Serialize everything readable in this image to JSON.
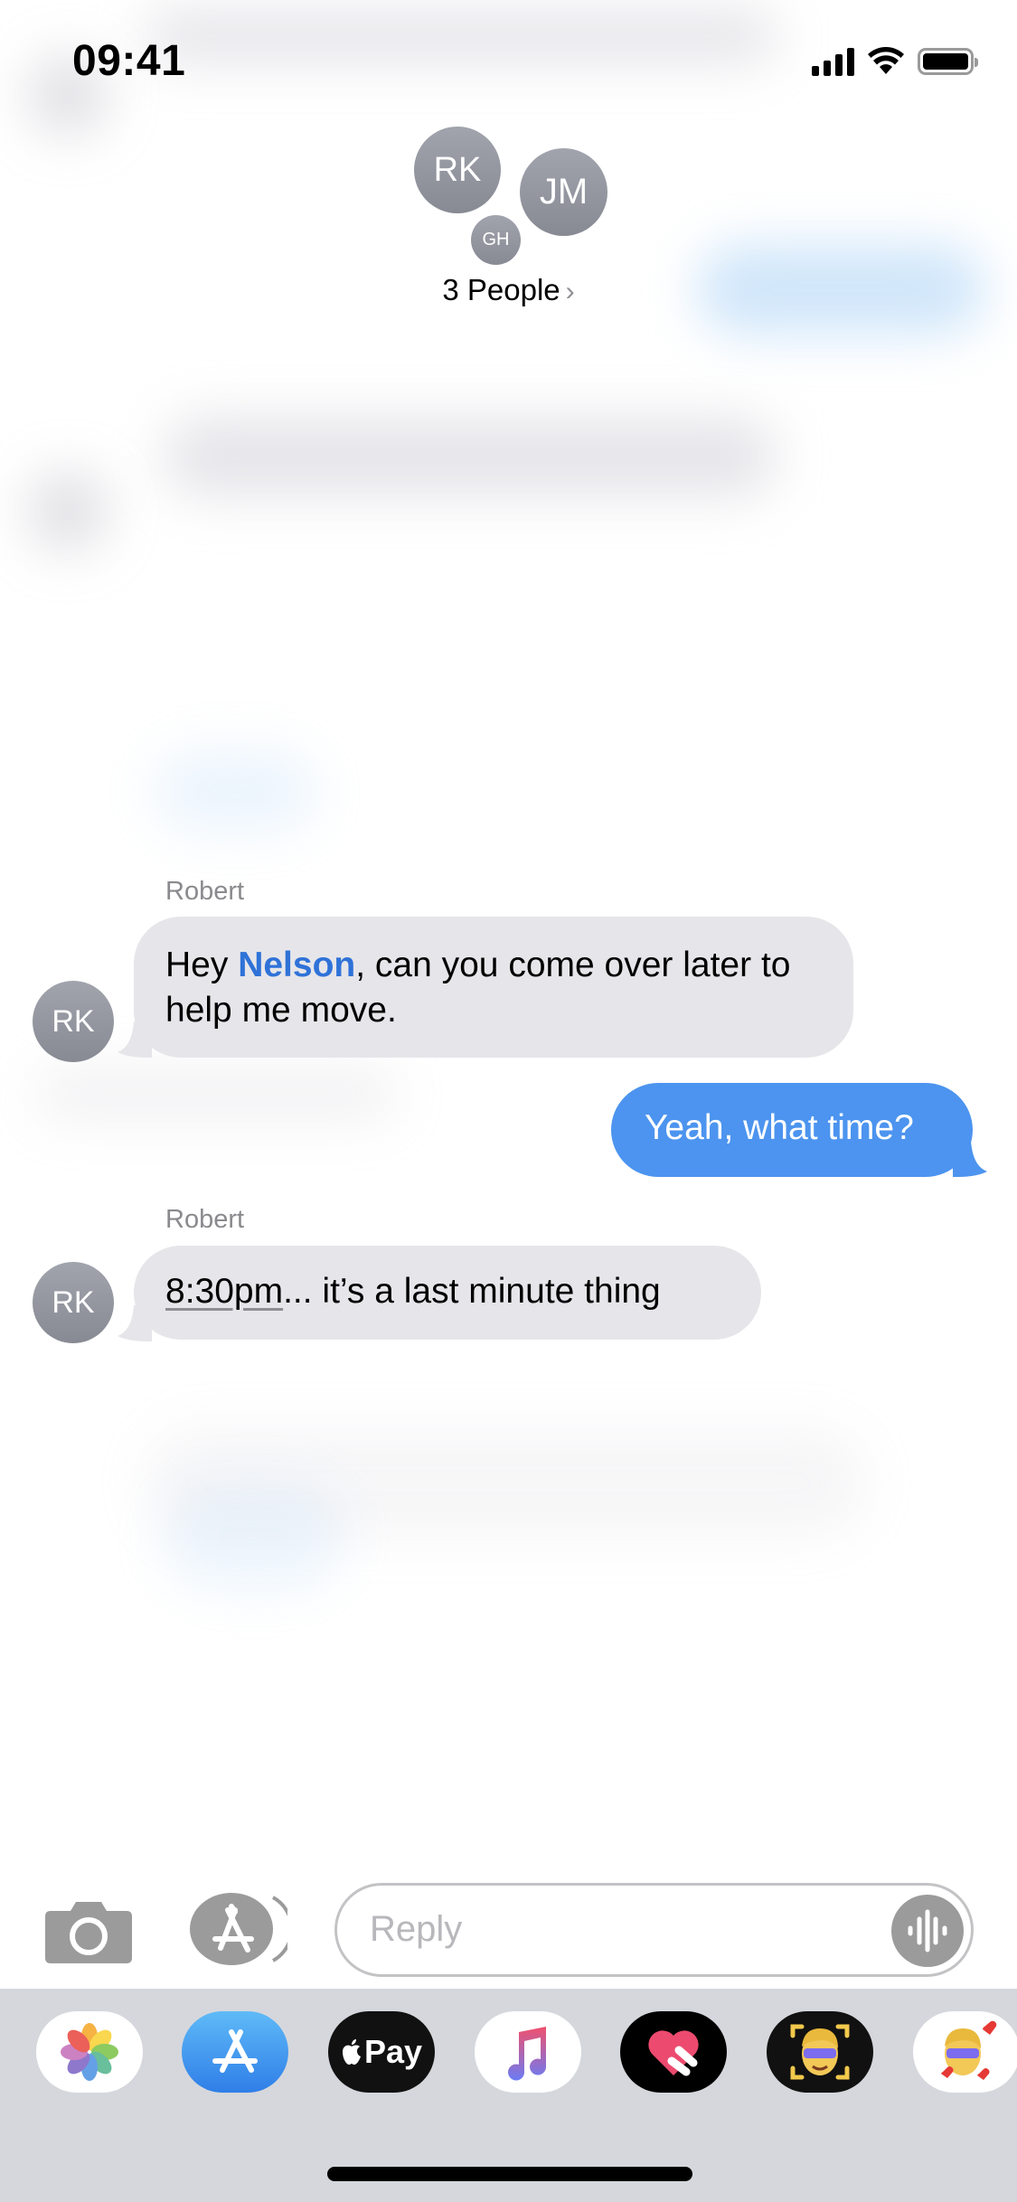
{
  "status_bar": {
    "time": "09:41",
    "signal_icon": "cellular-signal-icon",
    "wifi_icon": "wifi-icon",
    "battery_icon": "battery-full-icon"
  },
  "header": {
    "avatars": [
      {
        "initials": "RK"
      },
      {
        "initials": "JM"
      },
      {
        "initials": "GH"
      }
    ],
    "title": "3 People",
    "chevron": "›"
  },
  "messages": [
    {
      "direction": "incoming",
      "sender": "Robert",
      "avatar_initials": "RK",
      "text_parts": [
        "Hey ",
        "Nelson",
        ", can you come over later to help me move."
      ],
      "mention": "Nelson"
    },
    {
      "direction": "outgoing",
      "text": "Yeah, what time?"
    },
    {
      "direction": "incoming",
      "sender": "Robert",
      "avatar_initials": "RK",
      "text_parts": [
        "8:30pm",
        "... it’s a last minute thing"
      ],
      "detected_date": "8:30pm"
    }
  ],
  "input_bar": {
    "camera_icon": "camera-icon",
    "apps_icon": "app-store-icon",
    "placeholder": "Reply",
    "audio_icon": "audio-waveform-icon"
  },
  "app_drawer": {
    "apps": [
      {
        "name": "Photos",
        "icon": "photos-icon"
      },
      {
        "name": "App Store",
        "icon": "app-store-icon"
      },
      {
        "name": "Apple Pay",
        "icon": "apple-pay-icon",
        "label": "Pay"
      },
      {
        "name": "Music",
        "icon": "music-icon"
      },
      {
        "name": "Digital Touch",
        "icon": "digital-touch-icon"
      },
      {
        "name": "Memoji",
        "icon": "memoji-icon"
      },
      {
        "name": "Memoji Stickers",
        "icon": "memoji-stickers-icon"
      }
    ]
  },
  "colors": {
    "outgoing_bubble": "#4c94ef",
    "incoming_bubble": "#e6e6ea",
    "mention": "#2f72d8",
    "avatar": "#8e9199",
    "drawer_bg": "#d5d7dc"
  }
}
